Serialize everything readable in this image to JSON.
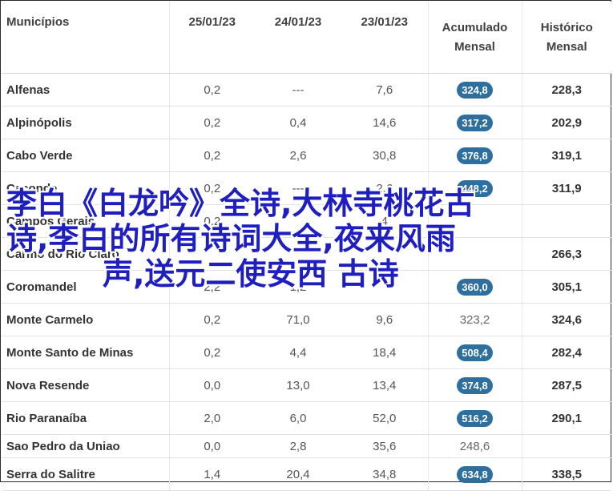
{
  "table": {
    "headers": {
      "municipios": "Municípios",
      "d1": "25/01/23",
      "d2": "24/01/23",
      "d3": "23/01/23",
      "acumulado_l1": "Acumulado",
      "acumulado_l2": "Mensal",
      "historico_l1": "Histórico",
      "historico_l2": "Mensal"
    },
    "rows": [
      {
        "name": "Alfenas",
        "d1": "0,2",
        "d2": "---",
        "d3": "7,6",
        "acum": "324,8",
        "hist": "228,3",
        "badge": true
      },
      {
        "name": "Alpinópolis",
        "d1": "0,2",
        "d2": "0,4",
        "d3": "14,6",
        "acum": "317,2",
        "hist": "202,9",
        "badge": true
      },
      {
        "name": "Cabo Verde",
        "d1": "0,2",
        "d2": "2,6",
        "d3": "30,8",
        "acum": "376,8",
        "hist": "319,1",
        "badge": true
      },
      {
        "name": "Caconde",
        "d1": "0,2",
        "d2": "---",
        "d3": "2,6",
        "acum": "448,2",
        "hist": "311,9",
        "badge": true
      },
      {
        "name": "Campos Gerais",
        "d1": "0,2",
        "d2": "",
        "d3": "4",
        "acum": "",
        "hist": "",
        "badge": false
      },
      {
        "name": "Carmo do Rio Claro",
        "d1": "",
        "d2": "",
        "d3": "",
        "acum": "",
        "hist": "266,3",
        "badge": false
      },
      {
        "name": "Coromandel",
        "d1": "2,2",
        "d2": "1,2",
        "d3": "",
        "acum": "360,0",
        "hist": "305,1",
        "badge": true
      },
      {
        "name": "Monte Carmelo",
        "d1": "0,2",
        "d2": "71,0",
        "d3": "9,6",
        "acum": "323,2",
        "hist": "324,6",
        "badge": false
      },
      {
        "name": "Monte Santo de Minas",
        "d1": "0,2",
        "d2": "4,4",
        "d3": "18,4",
        "acum": "508,4",
        "hist": "282,4",
        "badge": true
      },
      {
        "name": "Nova Resende",
        "d1": "0,0",
        "d2": "13,0",
        "d3": "13,4",
        "acum": "374,8",
        "hist": "287,5",
        "badge": true
      },
      {
        "name": "Rio Paranaíba",
        "d1": "2,0",
        "d2": "6,0",
        "d3": "52,0",
        "acum": "516,2",
        "hist": "290,1",
        "badge": true
      },
      {
        "name": "Sao Pedro da Uniao",
        "d1": "0,0",
        "d2": "2,8",
        "d3": "35,6",
        "acum": "248,6",
        "hist": "",
        "badge": false
      },
      {
        "name": "Serra do Salitre",
        "d1": "1,4",
        "d2": "20,4",
        "d3": "34,8",
        "acum": "634,8",
        "hist": "338,5",
        "badge": true
      }
    ]
  },
  "overlay": {
    "line1": "李白《白龙吟》全诗,大林寺桃花古",
    "line2": "诗,李白的所有诗词大全,夜来风雨",
    "line3": "声,送元二使安西 古诗"
  },
  "colors": {
    "badge": "#2e6f9e",
    "overlay_text": "#1f1fbf"
  }
}
